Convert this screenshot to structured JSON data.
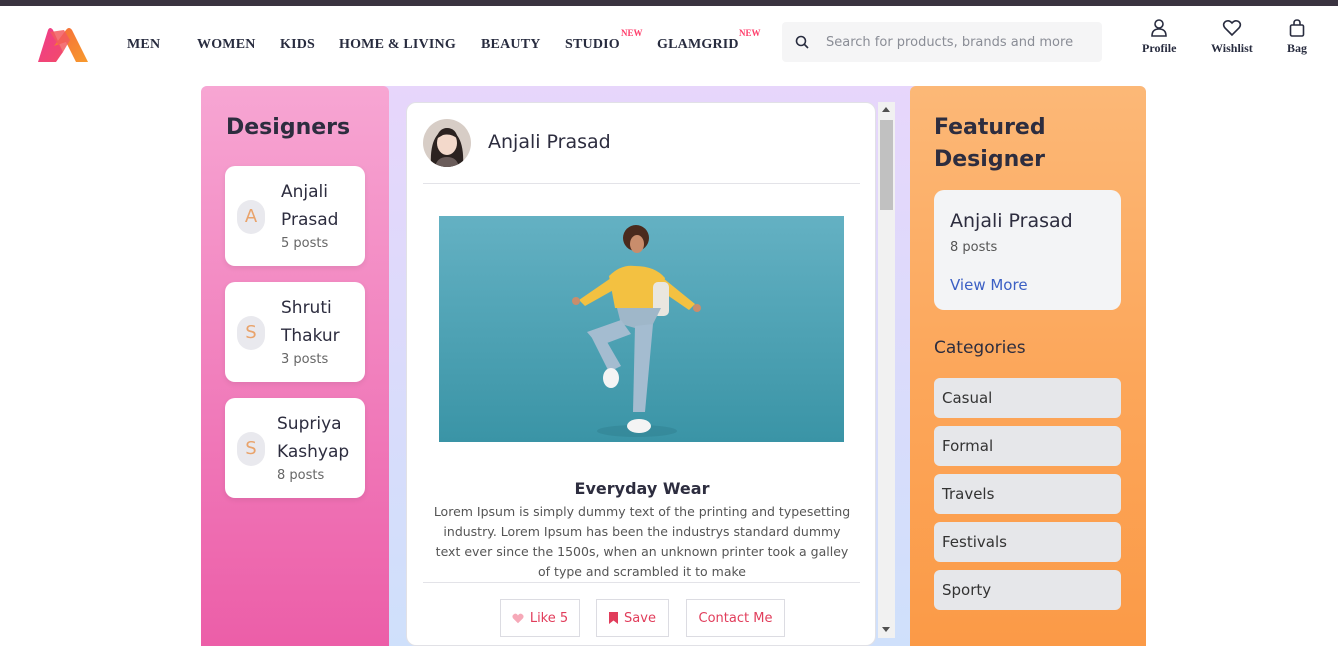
{
  "header": {
    "nav": [
      {
        "label": "MEN"
      },
      {
        "label": "WOMEN"
      },
      {
        "label": "KIDS"
      },
      {
        "label": "HOME & LIVING"
      },
      {
        "label": "BEAUTY"
      },
      {
        "label": "STUDIO",
        "badge": "NEW"
      },
      {
        "label": "GLAMGRID",
        "badge": "NEW"
      }
    ],
    "search_placeholder": "Search for products, brands and more",
    "actions": {
      "profile": "Profile",
      "wishlist": "Wishlist",
      "bag": "Bag"
    }
  },
  "designers": {
    "title": "Designers",
    "items": [
      {
        "initial": "A",
        "name": "Anjali Prasad",
        "posts": "5 posts"
      },
      {
        "initial": "S",
        "name": "Shruti Thakur",
        "posts": "3 posts"
      },
      {
        "initial": "S",
        "name": "Supriya Kashyap",
        "posts": "8 posts"
      }
    ]
  },
  "post": {
    "author": "Anjali Prasad",
    "title": "Everyday Wear",
    "body": "Lorem Ipsum is simply dummy text of the printing and typesetting industry. Lorem Ipsum has been the industrys standard dummy text ever since the 1500s, when an unknown printer took a galley of type and scrambled it to make",
    "like_label": "Like 5",
    "save_label": "Save",
    "contact_label": "Contact Me"
  },
  "featured": {
    "title": "Featured Designer",
    "name": "Anjali Prasad",
    "posts": "8 posts",
    "link": "View More"
  },
  "categories": {
    "title": "Categories",
    "items": [
      "Casual",
      "Formal",
      "Travels",
      "Festivals",
      "Sporty"
    ]
  },
  "colors": {
    "brand_pink": "#ff3f6c",
    "accent_link": "#3b5fc4",
    "button_text": "#e13d5b"
  }
}
